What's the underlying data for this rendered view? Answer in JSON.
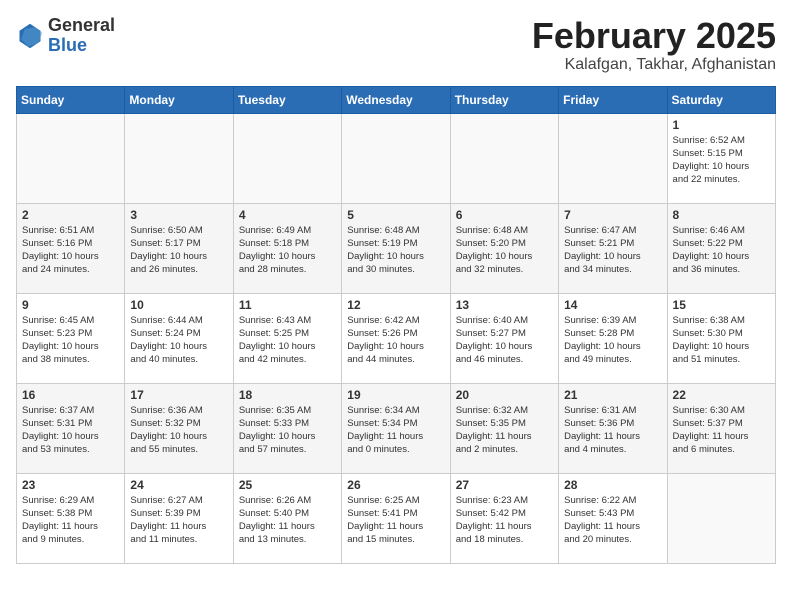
{
  "header": {
    "logo_general": "General",
    "logo_blue": "Blue",
    "month_title": "February 2025",
    "location": "Kalafgan, Takhar, Afghanistan"
  },
  "days_of_week": [
    "Sunday",
    "Monday",
    "Tuesday",
    "Wednesday",
    "Thursday",
    "Friday",
    "Saturday"
  ],
  "weeks": [
    [
      {
        "day": "",
        "info": ""
      },
      {
        "day": "",
        "info": ""
      },
      {
        "day": "",
        "info": ""
      },
      {
        "day": "",
        "info": ""
      },
      {
        "day": "",
        "info": ""
      },
      {
        "day": "",
        "info": ""
      },
      {
        "day": "1",
        "info": "Sunrise: 6:52 AM\nSunset: 5:15 PM\nDaylight: 10 hours\nand 22 minutes."
      }
    ],
    [
      {
        "day": "2",
        "info": "Sunrise: 6:51 AM\nSunset: 5:16 PM\nDaylight: 10 hours\nand 24 minutes."
      },
      {
        "day": "3",
        "info": "Sunrise: 6:50 AM\nSunset: 5:17 PM\nDaylight: 10 hours\nand 26 minutes."
      },
      {
        "day": "4",
        "info": "Sunrise: 6:49 AM\nSunset: 5:18 PM\nDaylight: 10 hours\nand 28 minutes."
      },
      {
        "day": "5",
        "info": "Sunrise: 6:48 AM\nSunset: 5:19 PM\nDaylight: 10 hours\nand 30 minutes."
      },
      {
        "day": "6",
        "info": "Sunrise: 6:48 AM\nSunset: 5:20 PM\nDaylight: 10 hours\nand 32 minutes."
      },
      {
        "day": "7",
        "info": "Sunrise: 6:47 AM\nSunset: 5:21 PM\nDaylight: 10 hours\nand 34 minutes."
      },
      {
        "day": "8",
        "info": "Sunrise: 6:46 AM\nSunset: 5:22 PM\nDaylight: 10 hours\nand 36 minutes."
      }
    ],
    [
      {
        "day": "9",
        "info": "Sunrise: 6:45 AM\nSunset: 5:23 PM\nDaylight: 10 hours\nand 38 minutes."
      },
      {
        "day": "10",
        "info": "Sunrise: 6:44 AM\nSunset: 5:24 PM\nDaylight: 10 hours\nand 40 minutes."
      },
      {
        "day": "11",
        "info": "Sunrise: 6:43 AM\nSunset: 5:25 PM\nDaylight: 10 hours\nand 42 minutes."
      },
      {
        "day": "12",
        "info": "Sunrise: 6:42 AM\nSunset: 5:26 PM\nDaylight: 10 hours\nand 44 minutes."
      },
      {
        "day": "13",
        "info": "Sunrise: 6:40 AM\nSunset: 5:27 PM\nDaylight: 10 hours\nand 46 minutes."
      },
      {
        "day": "14",
        "info": "Sunrise: 6:39 AM\nSunset: 5:28 PM\nDaylight: 10 hours\nand 49 minutes."
      },
      {
        "day": "15",
        "info": "Sunrise: 6:38 AM\nSunset: 5:30 PM\nDaylight: 10 hours\nand 51 minutes."
      }
    ],
    [
      {
        "day": "16",
        "info": "Sunrise: 6:37 AM\nSunset: 5:31 PM\nDaylight: 10 hours\nand 53 minutes."
      },
      {
        "day": "17",
        "info": "Sunrise: 6:36 AM\nSunset: 5:32 PM\nDaylight: 10 hours\nand 55 minutes."
      },
      {
        "day": "18",
        "info": "Sunrise: 6:35 AM\nSunset: 5:33 PM\nDaylight: 10 hours\nand 57 minutes."
      },
      {
        "day": "19",
        "info": "Sunrise: 6:34 AM\nSunset: 5:34 PM\nDaylight: 11 hours\nand 0 minutes."
      },
      {
        "day": "20",
        "info": "Sunrise: 6:32 AM\nSunset: 5:35 PM\nDaylight: 11 hours\nand 2 minutes."
      },
      {
        "day": "21",
        "info": "Sunrise: 6:31 AM\nSunset: 5:36 PM\nDaylight: 11 hours\nand 4 minutes."
      },
      {
        "day": "22",
        "info": "Sunrise: 6:30 AM\nSunset: 5:37 PM\nDaylight: 11 hours\nand 6 minutes."
      }
    ],
    [
      {
        "day": "23",
        "info": "Sunrise: 6:29 AM\nSunset: 5:38 PM\nDaylight: 11 hours\nand 9 minutes."
      },
      {
        "day": "24",
        "info": "Sunrise: 6:27 AM\nSunset: 5:39 PM\nDaylight: 11 hours\nand 11 minutes."
      },
      {
        "day": "25",
        "info": "Sunrise: 6:26 AM\nSunset: 5:40 PM\nDaylight: 11 hours\nand 13 minutes."
      },
      {
        "day": "26",
        "info": "Sunrise: 6:25 AM\nSunset: 5:41 PM\nDaylight: 11 hours\nand 15 minutes."
      },
      {
        "day": "27",
        "info": "Sunrise: 6:23 AM\nSunset: 5:42 PM\nDaylight: 11 hours\nand 18 minutes."
      },
      {
        "day": "28",
        "info": "Sunrise: 6:22 AM\nSunset: 5:43 PM\nDaylight: 11 hours\nand 20 minutes."
      },
      {
        "day": "",
        "info": ""
      }
    ]
  ]
}
